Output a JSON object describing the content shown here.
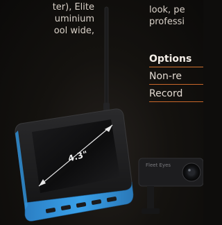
{
  "left_text": {
    "line1": "ter), Elite",
    "line2": "uminium",
    "line3": "ool wide,"
  },
  "right_text": {
    "line1": "look, pe",
    "line2": "professi"
  },
  "options_table": {
    "header": "Options",
    "rows": [
      "Non-re",
      "Record"
    ]
  },
  "device": {
    "screen_size_label": "4.3\"",
    "accent_color": "#2f8fd6",
    "camera_brand_text": "Fleet Eyes"
  },
  "colors": {
    "table_rule": "#c9672a",
    "background": "#0e0d0c"
  }
}
